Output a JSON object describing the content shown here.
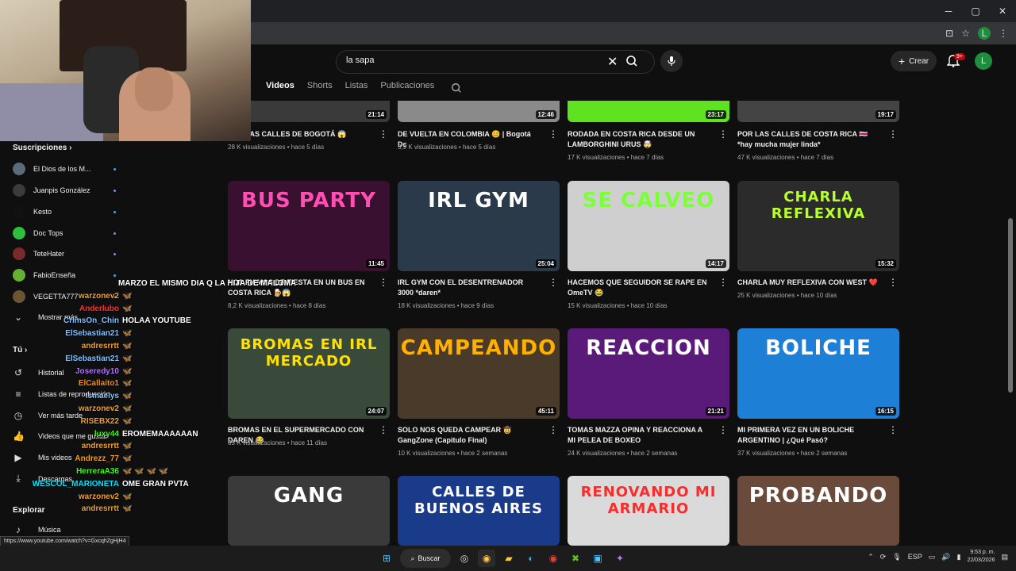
{
  "browser": {
    "window_controls": {
      "minimize": "─",
      "maximize": "▢",
      "close": "✕"
    },
    "profile_initial": "L"
  },
  "youtube": {
    "search": {
      "value": "la sapa",
      "placeholder": "Buscar"
    },
    "create_label": "Crear",
    "notification_count": "9+",
    "user_initial": "L",
    "tabs": [
      {
        "label": "Videos",
        "active": true
      },
      {
        "label": "Shorts"
      },
      {
        "label": "Listas"
      },
      {
        "label": "Publicaciones"
      }
    ]
  },
  "sidebar": {
    "subs_title": "Suscripciones",
    "subs": [
      {
        "name": "El Dios de los M...",
        "color": "#5a6b7c"
      },
      {
        "name": "Juanpis González",
        "color": "#3b3b3b"
      },
      {
        "name": "Kesto",
        "color": "#111111"
      },
      {
        "name": "Doc Tops",
        "color": "#2fbf3f"
      },
      {
        "name": "TeteHater",
        "color": "#7a2a2a"
      },
      {
        "name": "FabioEnseña",
        "color": "#66b033"
      },
      {
        "name": "VEGETTA777",
        "color": "#6b5533"
      }
    ],
    "show_more": "Mostrar más",
    "you_title": "Tú",
    "you_items": [
      {
        "label": "Historial",
        "icon": "history-icon"
      },
      {
        "label": "Listas de reproducción",
        "icon": "playlist-icon"
      },
      {
        "label": "Ver más tarde",
        "icon": "clock-icon"
      },
      {
        "label": "Videos que me gustan",
        "icon": "like-icon"
      },
      {
        "label": "Mis videos",
        "icon": "play-icon"
      },
      {
        "label": "Descargas",
        "icon": "download-icon"
      }
    ],
    "explore_title": "Explorar",
    "explore_items": [
      {
        "label": "Música",
        "icon": "music-icon"
      }
    ]
  },
  "chat": [
    {
      "user": "",
      "msg": "MARZO EL MISMO DIA Q LA HIJA DE MALOMA",
      "color": "#ffffff"
    },
    {
      "user": "warzonev2",
      "msg": "🦋",
      "color": "#f0a030"
    },
    {
      "user": "Anderlubo",
      "msg": "🦋",
      "color": "#ff3030"
    },
    {
      "user": "CrimsOn_Chin",
      "msg": "HOLAA YOUTUBE",
      "color": "#7fc0ff"
    },
    {
      "user": "ElSebastian21",
      "msg": "🦋",
      "color": "#7fc0ff"
    },
    {
      "user": "andresrrtt",
      "msg": "🦋",
      "color": "#f0a030"
    },
    {
      "user": "ElSebastian21",
      "msg": "🦋",
      "color": "#7fc0ff"
    },
    {
      "user": "Joseredy10",
      "msg": "🦋",
      "color": "#b070ff"
    },
    {
      "user": "ElCallaito1",
      "msg": "🦋",
      "color": "#ff8c00"
    },
    {
      "user": "Ismaelys",
      "msg": "🦋",
      "color": "#7fc0ff"
    },
    {
      "user": "warzonev2",
      "msg": "🦋",
      "color": "#f0a030"
    },
    {
      "user": "RISEBX22",
      "msg": "🦋",
      "color": "#f0a030"
    },
    {
      "user": "luxy44",
      "msg": "EROMEMAAAAAAN",
      "color": "#39ff14"
    },
    {
      "user": "andresrrtt",
      "msg": "🦋",
      "color": "#f0a030"
    },
    {
      "user": "Andrezz_77",
      "msg": "🦋",
      "color": "#f0a030"
    },
    {
      "user": "HerreraA36",
      "msg": "🦋 🦋 🦋 🦋",
      "color": "#39ff14"
    },
    {
      "user": "WESCOL_MARIONETA",
      "msg": "OME GRAN PVTA",
      "color": "#00e5ff"
    },
    {
      "user": "warzonev2",
      "msg": "🦋",
      "color": "#f0a030"
    },
    {
      "user": "andresrrtt",
      "msg": "🦋",
      "color": "#f0a030"
    }
  ],
  "videos": [
    {
      "title": "POR LAS CALLES DE BOGOTÁ 😱",
      "meta": "28 K visualizaciones • hace 5 días",
      "dur": "21:14",
      "bg": "#3a3a3a",
      "thumb": ""
    },
    {
      "title": "DE VUELTA EN COLOMBIA 😊 | Bogotá Dc",
      "meta": "3,9 K visualizaciones • hace 5 días",
      "dur": "12:46",
      "bg": "#8a8a8a",
      "thumb": ""
    },
    {
      "title": "RODADA EN COSTA RICA DESDE UN LAMBORGHINI URUS 🤯",
      "meta": "17 K visualizaciones • hace 7 días",
      "dur": "23:17",
      "bg": "#5fe21f",
      "thumb": ""
    },
    {
      "title": "POR LAS CALLES DE COSTA RICA 🇨🇷 *hay mucha mujer linda*",
      "meta": "47 K visualizaciones • hace 7 días",
      "dur": "19:17",
      "bg": "#444444",
      "thumb": ""
    },
    {
      "title": "NOS FUIMOS DE FIESTA EN UN BUS EN COSTA RICA 🍺😱",
      "meta": "8,2 K visualizaciones • hace 8 días",
      "dur": "11:45",
      "bg": "#3a1030",
      "thumb": "BUS PARTY",
      "tcolor": "#ff4fb3"
    },
    {
      "title": "IRL GYM CON EL DESENTRENADOR 3000 *daren*",
      "meta": "18 K visualizaciones • hace 9 días",
      "dur": "25:04",
      "bg": "#2a3a4a",
      "thumb": "IRL GYM",
      "tcolor": "#ffffff"
    },
    {
      "title": "HACEMOS QUE SEGUIDOR SE RAPE EN OmeTV 😂",
      "meta": "15 K visualizaciones • hace 10 días",
      "dur": "14:17",
      "bg": "#cfcfcf",
      "thumb": "SE CALVEO",
      "tcolor": "#7cff3a"
    },
    {
      "title": "CHARLA MUY REFLEXIVA CON WEST ❤️",
      "meta": "25 K visualizaciones • hace 10 días",
      "dur": "15:32",
      "bg": "#2b2b2b",
      "thumb": "CHARLA REFLEXIVA",
      "tcolor": "#b6ff2a"
    },
    {
      "title": "BROMAS EN EL SUPERMERCADO CON DAREN 😂",
      "meta": "85 K visualizaciones • hace 11 días",
      "dur": "24:07",
      "bg": "#3a4a3a",
      "thumb": "BROMAS EN IRL MERCADO",
      "tcolor": "#ffe100"
    },
    {
      "title": "SOLO NOS QUEDA CAMPEAR 🤠 GangZone (Capitulo Final)",
      "meta": "10 K visualizaciones • hace 2 semanas",
      "dur": "45:11",
      "bg": "#4a3a2a",
      "thumb": "CAMPEANDO",
      "tcolor": "#ffb000"
    },
    {
      "title": "TOMAS MAZZA OPINA Y REACCIONA A MI PELEA DE BOXEO",
      "meta": "24 K visualizaciones • hace 2 semanas",
      "dur": "21:21",
      "bg": "#5a1a7a",
      "thumb": "REACCION",
      "tcolor": "#ffffff"
    },
    {
      "title": "MI PRIMERA VEZ EN UN BOLICHE ARGENTINO | ¿Qué Pasó?",
      "meta": "37 K visualizaciones • hace 2 semanas",
      "dur": "16:15",
      "bg": "#1e7fd6",
      "thumb": "BOLICHE",
      "tcolor": "#ffffff"
    },
    {
      "title": "",
      "meta": "",
      "dur": "",
      "bg": "#3a3a3a",
      "thumb": "GANG",
      "tcolor": "#ffffff"
    },
    {
      "title": "",
      "meta": "",
      "dur": "",
      "bg": "#1a3a8a",
      "thumb": "CALLES DE BUENOS AIRES",
      "tcolor": "#ffffff"
    },
    {
      "title": "",
      "meta": "",
      "dur": "",
      "bg": "#dadada",
      "thumb": "RENOVANDO MI ARMARIO",
      "tcolor": "#ff2a2a"
    },
    {
      "title": "",
      "meta": "",
      "dur": "",
      "bg": "#6a4a3a",
      "thumb": "PROBANDO",
      "tcolor": "#ffffff"
    }
  ],
  "status_url": "https://www.youtube.com/watch?v=GxcqhZgHjH4",
  "taskbar": {
    "search_label": "Buscar",
    "lang": "ESP",
    "time": "9:53 p. m.",
    "date": "22/03/2026"
  }
}
